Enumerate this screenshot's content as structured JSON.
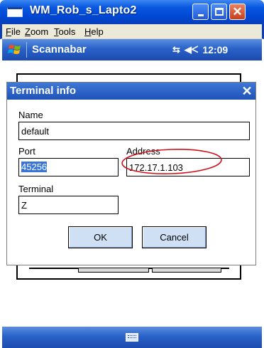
{
  "window": {
    "title": "WM_Rob_s_Lapto2",
    "close_glyph": "✕"
  },
  "menubar": {
    "items": [
      {
        "label": "File",
        "key": "F",
        "rest": "ile"
      },
      {
        "label": "Zoom",
        "key": "Z",
        "rest": "oom"
      },
      {
        "label": "Tools",
        "key": "T",
        "rest": "ools"
      },
      {
        "label": "Help",
        "key": "H",
        "rest": "elp"
      }
    ]
  },
  "device": {
    "taskbar": {
      "app_title": "Scannabar",
      "time": "12:09",
      "connectivity_glyph": "⇆",
      "volume_glyph": "◀ᐸ"
    }
  },
  "dialog": {
    "title": "Terminal info",
    "close_glyph": "✕",
    "name": {
      "label": "Name",
      "value": "default"
    },
    "port": {
      "label": "Port",
      "value": "45256"
    },
    "address": {
      "label": "Address",
      "value": "172.17.1.103"
    },
    "terminal": {
      "label": "Terminal",
      "value": "Z"
    },
    "ok_label": "OK",
    "cancel_label": "Cancel"
  },
  "colors": {
    "title_blue": "#0047d3",
    "menu_bg": "#ece9d8",
    "dialog_title_blue": "#1f52b8",
    "selection": "#3875d7",
    "button_face": "#cfe0f5",
    "annotation_red": "#d0101a"
  },
  "icons": {
    "window_icon": "window-icon",
    "start_flag": "windows-flag-icon",
    "keyboard": "keyboard-icon"
  }
}
